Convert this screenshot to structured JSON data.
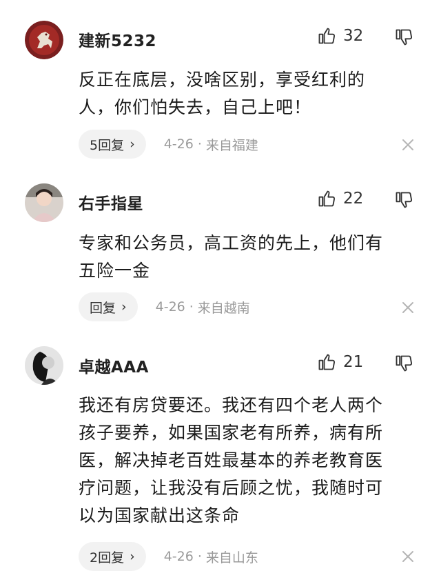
{
  "comments": [
    {
      "username": "建新5232",
      "avatar_icon": "horse-logo-avatar",
      "likes": "32",
      "text_lines": [
        "反正在底层，没啥区别，享受红利的",
        "人，你们怕失去，自己上吧！"
      ],
      "reply_label": "5回复",
      "date": "4-26",
      "sep": "·",
      "location": "来自福建"
    },
    {
      "username": "右手指星",
      "avatar_icon": "girl-photo-avatar",
      "likes": "22",
      "text_lines": [
        "专家和公务员，高工资的先上，他们有",
        "五险一金"
      ],
      "reply_label": "回复",
      "date": "4-26",
      "sep": "·",
      "location": "来自越南"
    },
    {
      "username": "卓越AAA",
      "avatar_icon": "bw-portrait-avatar",
      "likes": "21",
      "text_lines": [
        "我还有房贷要还。我还有四个老人两个",
        "孩子要养，如果国家老有所养，病有所",
        "医，解决掉老百姓最基本的养老教育医",
        "疗问题，让我没有后顾之忧，我随时可",
        "以为国家献出这条命"
      ],
      "reply_label": "2回复",
      "date": "4-26",
      "sep": "·",
      "location": "来自山东"
    }
  ],
  "icons": {
    "like": "thumbs-up-icon",
    "dislike": "thumbs-down-icon",
    "close": "close-icon",
    "chevron": "chevron-right-icon"
  },
  "colors": {
    "text": "#1b1b1b",
    "meta": "#9a9a9a",
    "reply_bg": "#f2f2f2"
  }
}
